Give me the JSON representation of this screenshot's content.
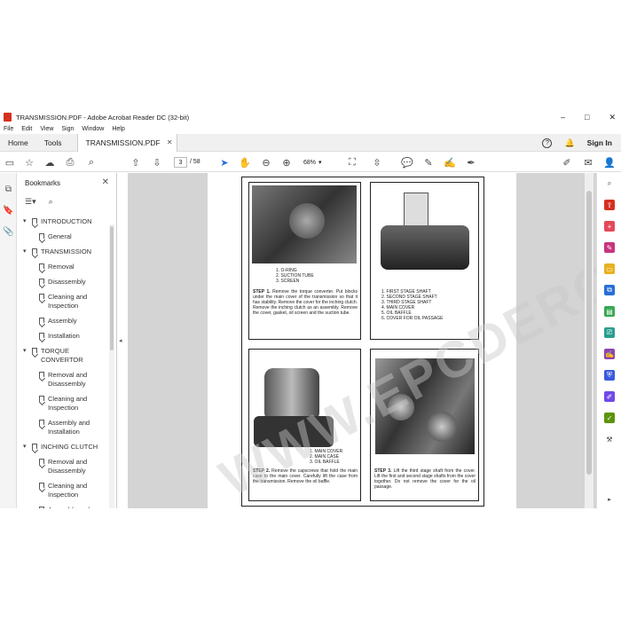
{
  "window": {
    "title": "TRANSMISSION.PDF - Adobe Acrobat Reader DC (32-bit)"
  },
  "menu": [
    "File",
    "Edit",
    "View",
    "Sign",
    "Window",
    "Help"
  ],
  "tabs": {
    "home": "Home",
    "tools": "Tools",
    "doc": "TRANSMISSION.PDF",
    "sign_in": "Sign In"
  },
  "toolbar": {
    "page_current": "3",
    "page_total": "/ 58",
    "zoom": "68%"
  },
  "bookmarks": {
    "title": "Bookmarks",
    "items": [
      {
        "label": "INTRODUCTION",
        "level": 0,
        "expanded": true
      },
      {
        "label": "General",
        "level": 1
      },
      {
        "label": "TRANSMISSION",
        "level": 0,
        "expanded": true
      },
      {
        "label": "Removal",
        "level": 1
      },
      {
        "label": "Disassembly",
        "level": 1
      },
      {
        "label": "Cleaning and Inspection",
        "level": 1
      },
      {
        "label": "Assembly",
        "level": 1
      },
      {
        "label": "Installation",
        "level": 1
      },
      {
        "label": "TORQUE CONVERTOR",
        "level": 0,
        "expanded": true
      },
      {
        "label": "Removal and Disassembly",
        "level": 1
      },
      {
        "label": "Cleaning and Inspection",
        "level": 1
      },
      {
        "label": "Assembly and Installation",
        "level": 1
      },
      {
        "label": "INCHING CLUTCH",
        "level": 0,
        "expanded": true
      },
      {
        "label": "Removal and Disassembly",
        "level": 1
      },
      {
        "label": "Cleaning and Inspection",
        "level": 1
      },
      {
        "label": "Assembly and Inspection",
        "level": 1
      }
    ]
  },
  "document": {
    "fig1": {
      "labels": [
        "1. O-RING",
        "2. SUCTION TUBE",
        "3. SCREEN"
      ],
      "step": "STEP 1.",
      "text": "Remove the torque converter. Put blocks under the main cover of the transmission so that it has stability. Remove the cover for the inching clutch. Remove the inching clutch as an assembly. Remove the cover, gasket, oil screen and the suction tube."
    },
    "fig2": {
      "labels": [
        "1. FIRST STAGE SHAFT",
        "2. SECOND STAGE SHAFT",
        "3. THIRD STAGE SHAFT",
        "4. MAIN COVER",
        "5. OIL BAFFLE",
        "6. COVER FOR OIL PASSAGE"
      ]
    },
    "fig3": {
      "labels": [
        "1. MAIN COVER",
        "2. MAIN CASE",
        "3. OIL BAFFLE"
      ],
      "step": "STEP 2.",
      "text": "Remove the capscrews that hold the main case to the main cover. Carefully lift the case from the transmission. Remove the oil baffle."
    },
    "fig4": {
      "step": "STEP 3.",
      "text": "Lift the third stage shaft from the cover. Lift the first and second stage shafts from the cover together. Do not remove the cover for the oil passage."
    }
  },
  "watermark": "WWW.EPCDERO.COM"
}
